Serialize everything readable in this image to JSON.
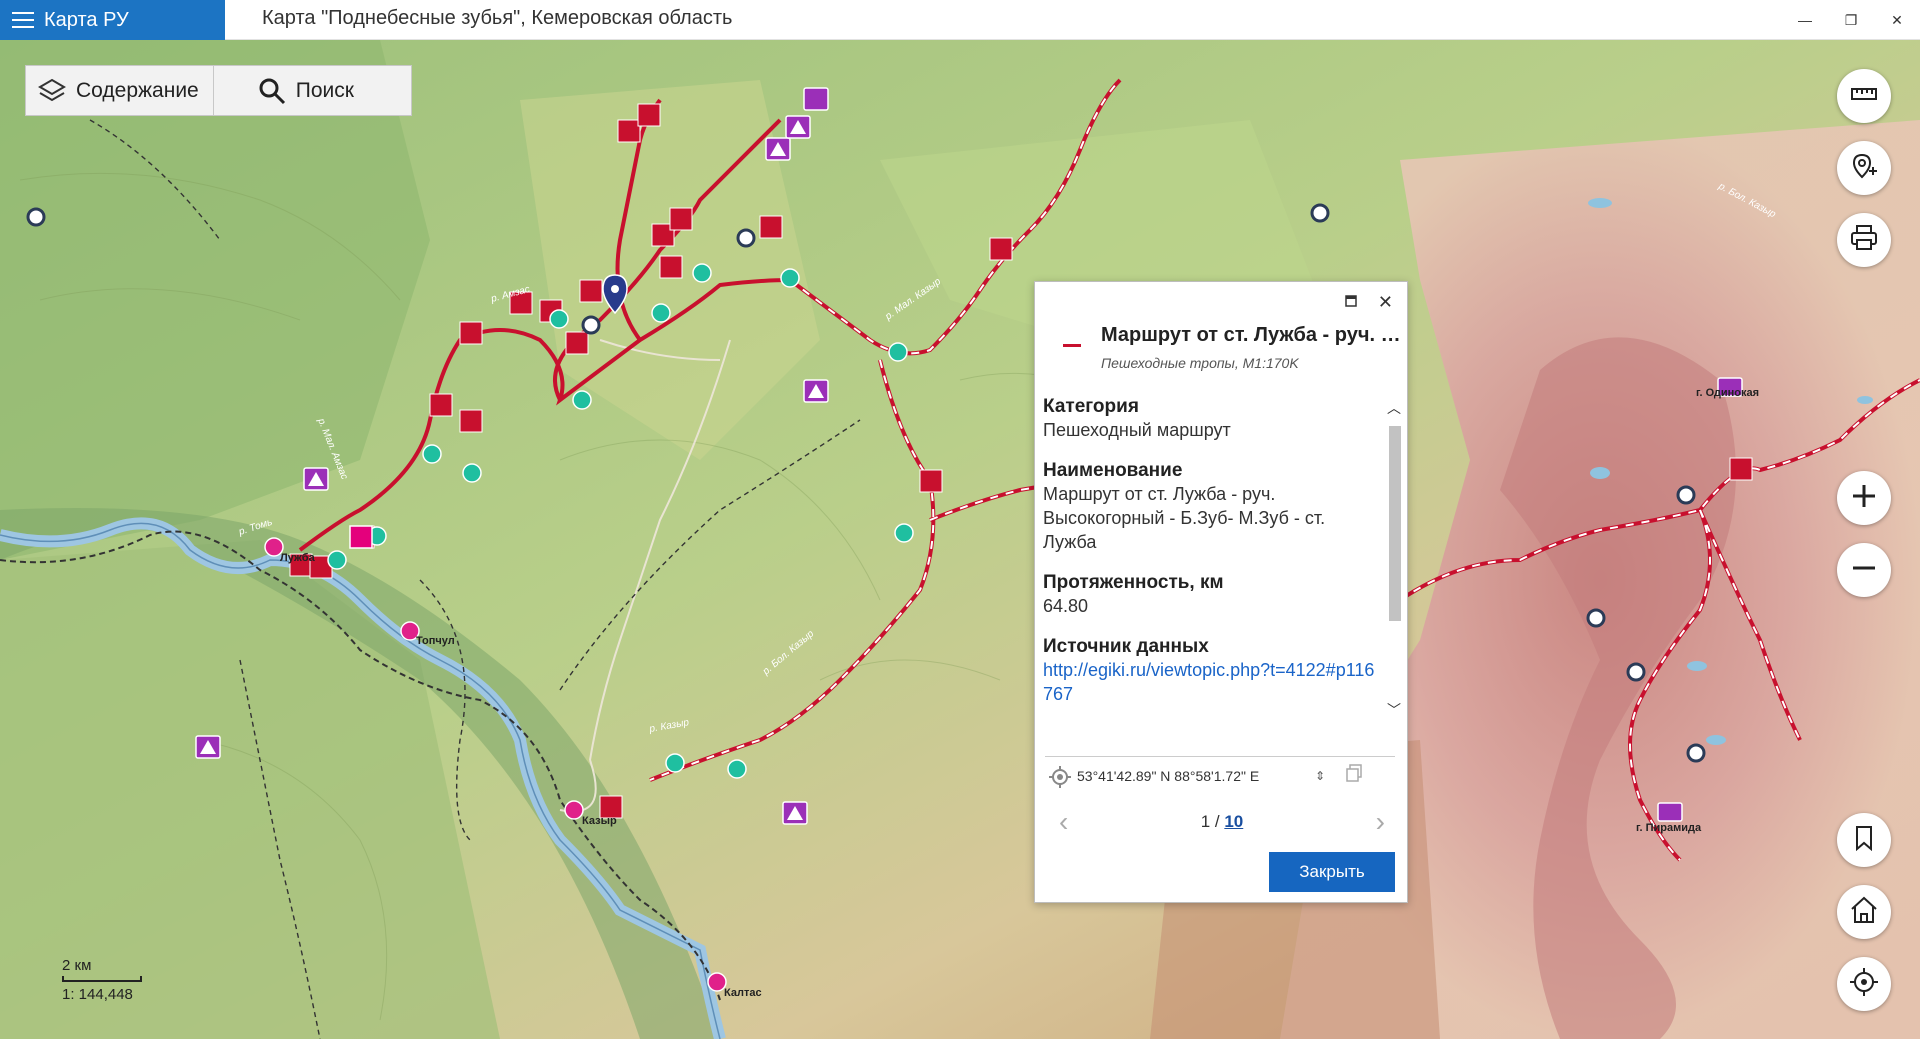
{
  "app": {
    "name": "Карта РУ",
    "window_title": "Карта \"Поднебесные зубья\", Кемеровская область"
  },
  "window_controls": {
    "minimize": "—",
    "restore": "❐",
    "close": "✕"
  },
  "toolbar": {
    "contents_label": "Содержание",
    "search_label": "Поиск"
  },
  "map": {
    "places": [
      {
        "name": "Лужба"
      },
      {
        "name": "Топчул"
      },
      {
        "name": "Казыр"
      },
      {
        "name": "Калтас"
      },
      {
        "name": "г. Одинокая"
      },
      {
        "name": "г. Пирамида"
      }
    ],
    "river_labels": [
      "р. Томь",
      "р. Мал. Казыр",
      "р. Бол. Казыр",
      "р. Казыр",
      "р. Мал. Амзас",
      "р. Амзас",
      "р. Бол. Казыр"
    ]
  },
  "popup": {
    "title": "Маршрут от ст. Лужба - руч. Высокогорный - Б.Зуб- М.Зуб - ст. Лужба",
    "subtitle": "Пешеходные тропы, M1:170K",
    "fields": [
      {
        "label": "Категория",
        "value": "Пешеходный маршрут"
      },
      {
        "label": "Наименование",
        "value": "Маршрут от ст. Лужба - руч. Высокогорный - Б.Зуб- М.Зуб - ст. Лужба"
      },
      {
        "label": "Протяженность, км",
        "value": "64.80"
      }
    ],
    "source_label": "Источник данных",
    "source_link": "http://egiki.ru/viewtopic.php?t=4122#p116767",
    "coordinates": "53°41'42.89\" N 88°58'1.72\" E",
    "page_current": "1 / ",
    "page_total": "10",
    "close_button": "Закрыть"
  },
  "scale": {
    "distance": "2 км",
    "ratio": "1: 144,448"
  },
  "colors": {
    "accent": "#1c74c3",
    "route": "#c8102e",
    "terrain_green": "#a9c67e",
    "mountain_pink": "#d9a6a6"
  }
}
